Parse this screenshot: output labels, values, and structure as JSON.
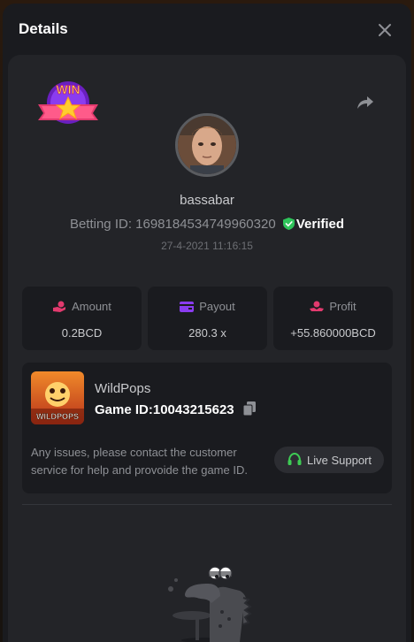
{
  "dialog": {
    "title": "Details"
  },
  "user": {
    "username": "bassabar",
    "betting_id_label": "Betting ID: ",
    "betting_id": "1698184534749960320",
    "verified_label": "Verified",
    "timestamp": "27-4-2021 11:16:15"
  },
  "badge": {
    "text": "WIN"
  },
  "stats": [
    {
      "label": "Amount",
      "value": "0.2BCD",
      "icon": "coin-hand-icon"
    },
    {
      "label": "Payout",
      "value": "280.3 x",
      "icon": "wallet-icon"
    },
    {
      "label": "Profit",
      "value": "+55.860000BCD",
      "icon": "hand-coin-icon"
    }
  ],
  "game": {
    "name": "WildPops",
    "thumb_text": "WILDPOPS",
    "id_label": "Game ID:",
    "id": "10043215623",
    "issue_text": "Any issues, please contact the customer service for help and provoide the game ID.",
    "support_label": "Live Support"
  },
  "colors": {
    "accent_pink": "#e23a6e",
    "accent_purple": "#8a3cf0",
    "verified_green": "#2ec45a",
    "support_green": "#3ecb54"
  }
}
